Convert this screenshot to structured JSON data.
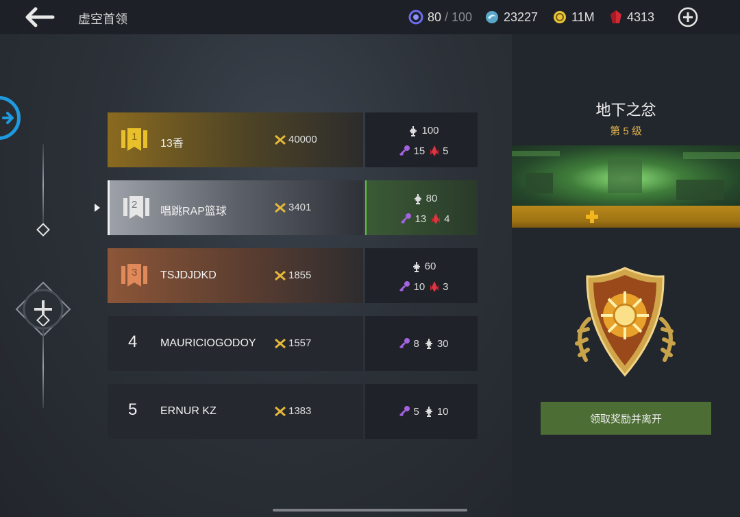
{
  "header": {
    "title": "虚空首领",
    "energy": {
      "current": "80",
      "max": "/ 100"
    },
    "orbs": "23227",
    "gold": "11M",
    "gems": "4313",
    "colors": {
      "bar": "#1d2026",
      "accent_blue": "#1e9be0"
    }
  },
  "leaderboard": {
    "rows": [
      {
        "rank": "1",
        "name": "13香",
        "score": "40000",
        "stat_top": "100",
        "keys": "15",
        "crystals": "5"
      },
      {
        "rank": "2",
        "name": "唱跳RAP篮球",
        "score": "3401",
        "stat_top": "80",
        "keys": "13",
        "crystals": "4"
      },
      {
        "rank": "3",
        "name": "TSJDJDKD",
        "score": "1855",
        "stat_top": "60",
        "keys": "10",
        "crystals": "3"
      },
      {
        "rank": "4",
        "name": "MAURICIOGODOY",
        "score": "1557",
        "keys": "8",
        "stat_top": "30"
      },
      {
        "rank": "5",
        "name": "ERNUR KZ",
        "score": "1383",
        "keys": "5",
        "stat_top": "10"
      }
    ]
  },
  "reward": {
    "title": "地下之忿",
    "level": "第 5 级",
    "claim_label": "领取奖励并离开",
    "colors": {
      "level": "#e4b64b",
      "claim_bg": "#4c6d34"
    }
  }
}
